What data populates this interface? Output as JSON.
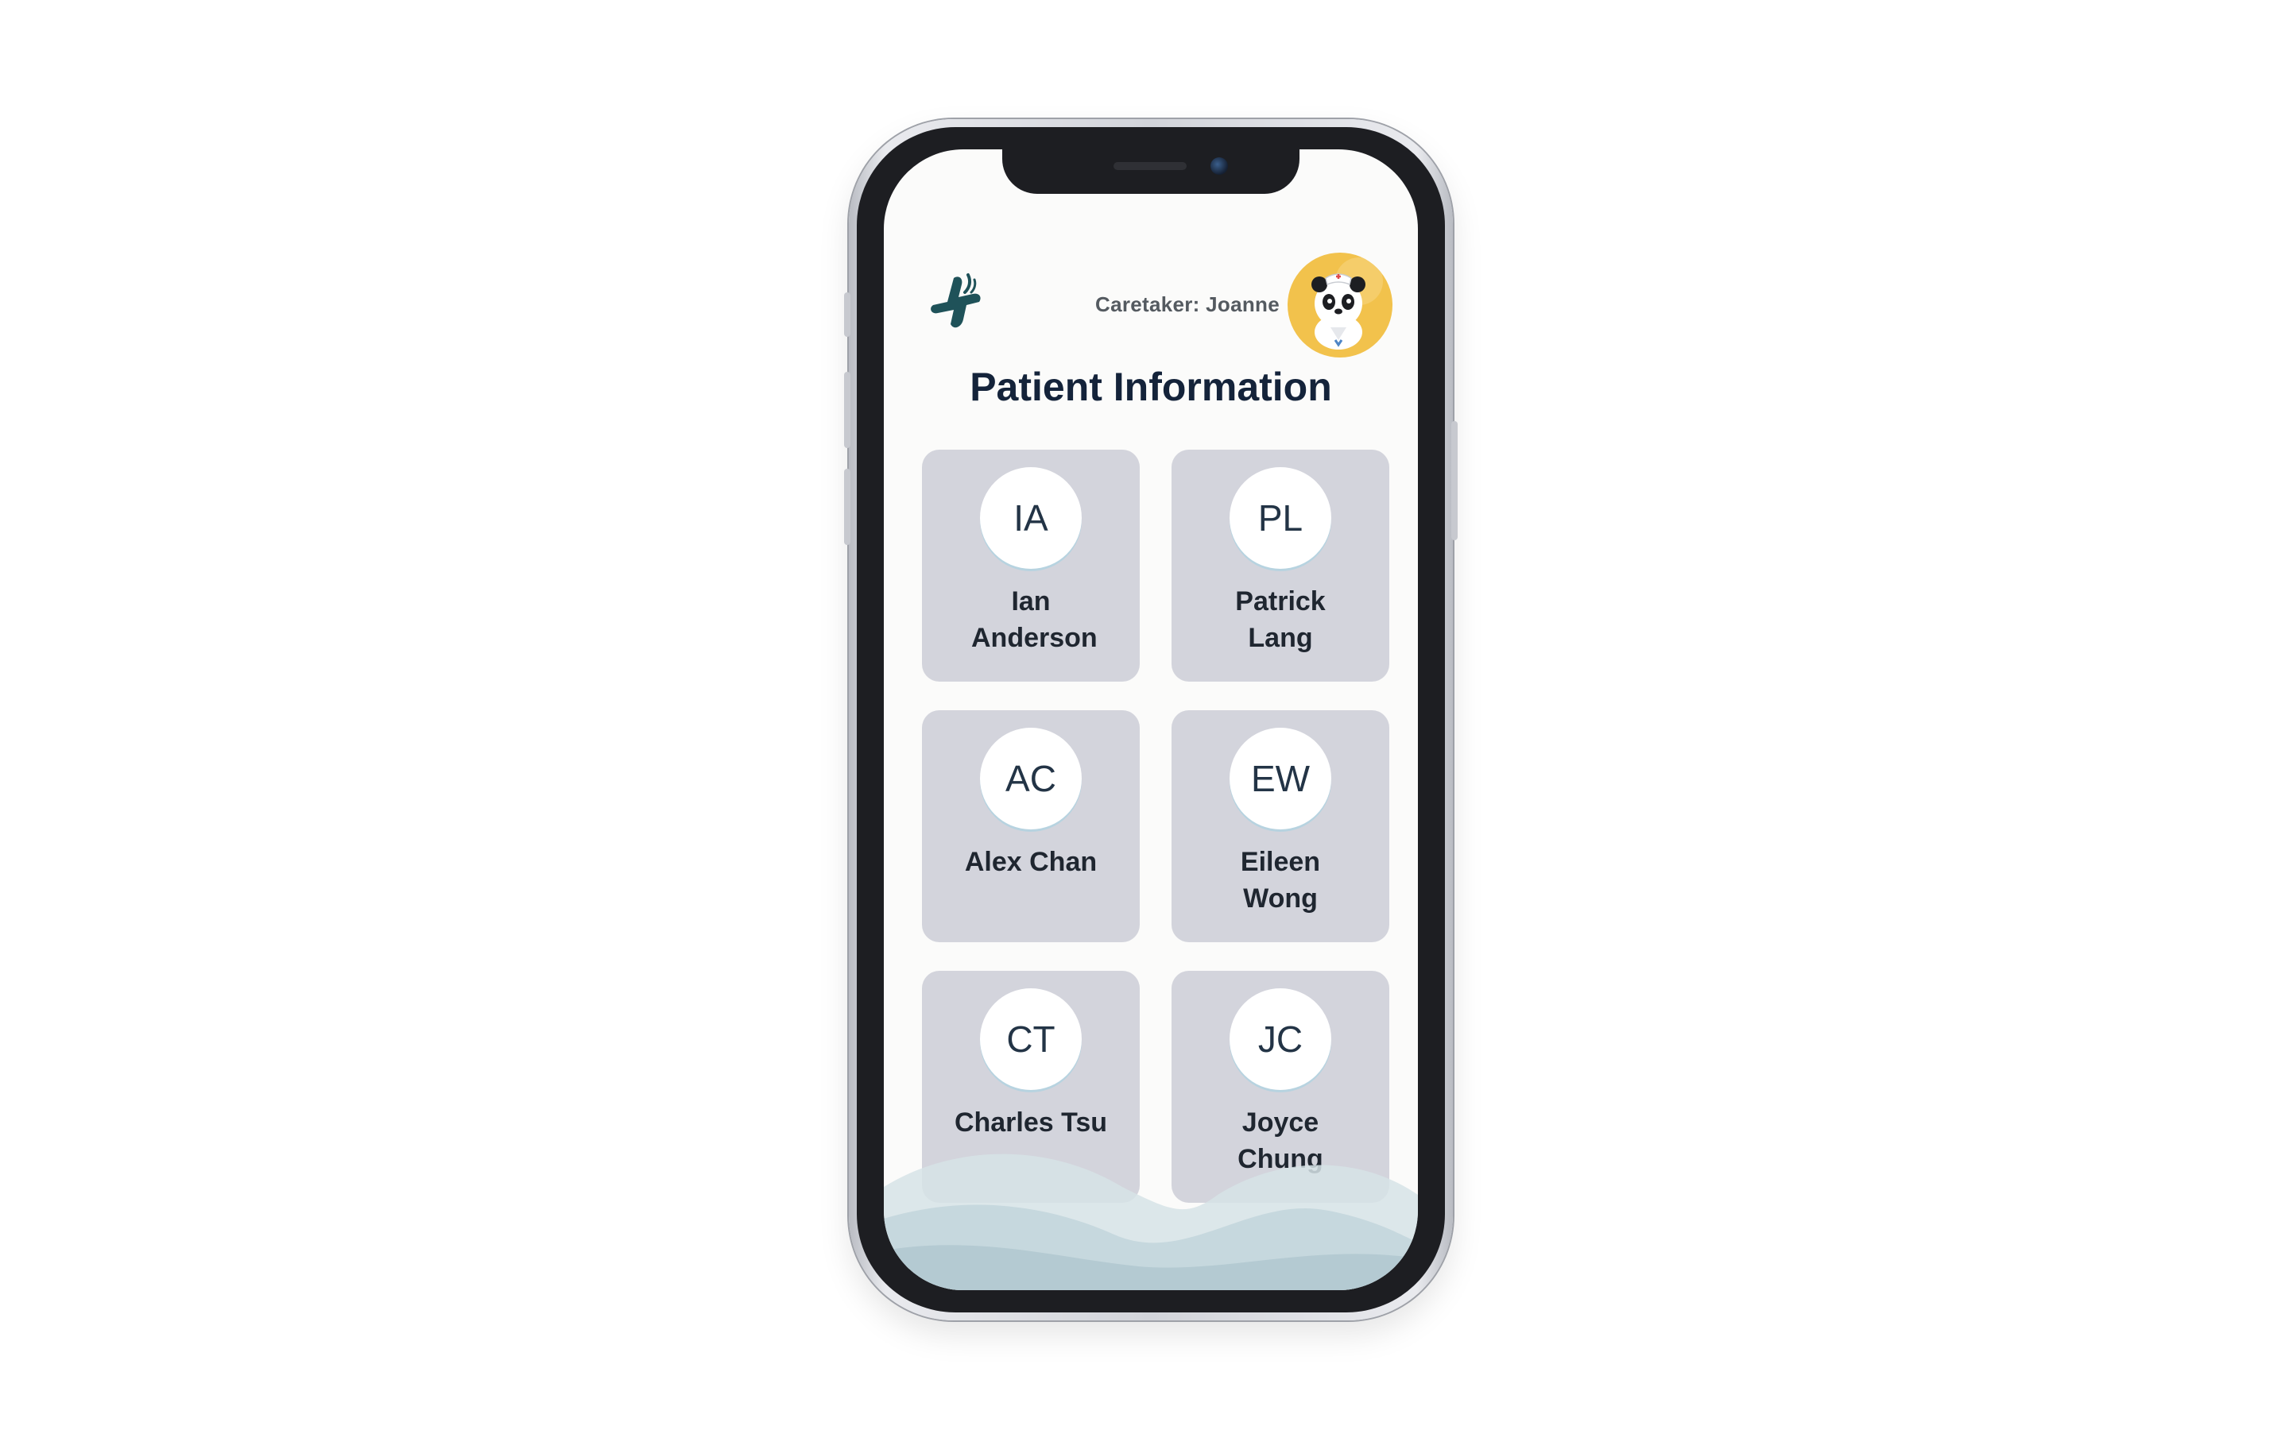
{
  "header": {
    "caretaker_label": "Caretaker: Joanne",
    "title": "Patient Information",
    "logo_icon": "medical-cross-logo-icon",
    "avatar_icon": "panda-nurse-avatar"
  },
  "patients": [
    {
      "initials": "IA",
      "name": "Ian Anderson"
    },
    {
      "initials": "PL",
      "name": "Patrick Lang"
    },
    {
      "initials": "AC",
      "name": "Alex Chan"
    },
    {
      "initials": "EW",
      "name": "Eileen Wong"
    },
    {
      "initials": "CT",
      "name": "Charles Tsu"
    },
    {
      "initials": "JC",
      "name": "Joyce Chung"
    }
  ],
  "colors": {
    "brand": "#1f5259",
    "title": "#14233a",
    "card": "#d3d4dc",
    "avatar_bg": "#f2c24c",
    "screen_bg": "#fbfbfa"
  }
}
